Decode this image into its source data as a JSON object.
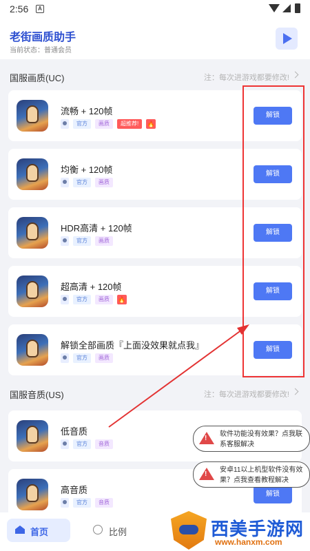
{
  "status_bar": {
    "time": "2:56",
    "notification_letter": "A"
  },
  "header": {
    "title": "老街画质助手",
    "status": "当前状态：普通会员"
  },
  "sections": [
    {
      "title": "国服画质(UC)",
      "note": "注：每次进游戏都要修改!"
    },
    {
      "title": "国服音质(US)",
      "note": "注：每次进游戏都要修改!"
    }
  ],
  "tags": {
    "official": "官方",
    "quality": "画质",
    "audio": "音质",
    "recommend": "超推荐!",
    "fire": "🔥"
  },
  "cards": [
    {
      "name": "流畅 + 120帧",
      "action": "解锁"
    },
    {
      "name": "均衡 + 120帧",
      "action": "解锁"
    },
    {
      "name": "HDR高清 + 120帧",
      "action": "解锁"
    },
    {
      "name": "超高清 + 120帧",
      "action": "解锁"
    },
    {
      "name": "解锁全部画质『上面没效果就点我』",
      "action": "解锁"
    },
    {
      "name": "低音质",
      "action": "解锁"
    },
    {
      "name": "高音质",
      "action": "解锁"
    }
  ],
  "bubbles": [
    {
      "text": "软件功能没有效果？点我联系客服解决"
    },
    {
      "text": "安卓11以上机型软件没有效果？点我查看教程解决"
    }
  ],
  "bottom_nav": {
    "home": "首页",
    "ratio": "比例"
  },
  "watermark": {
    "title": "西美手游网",
    "url": "www.hanxm.com"
  },
  "colors": {
    "accent": "#4e78f4",
    "title_blue": "#2d4fd0",
    "annotation_red": "#e33333"
  }
}
